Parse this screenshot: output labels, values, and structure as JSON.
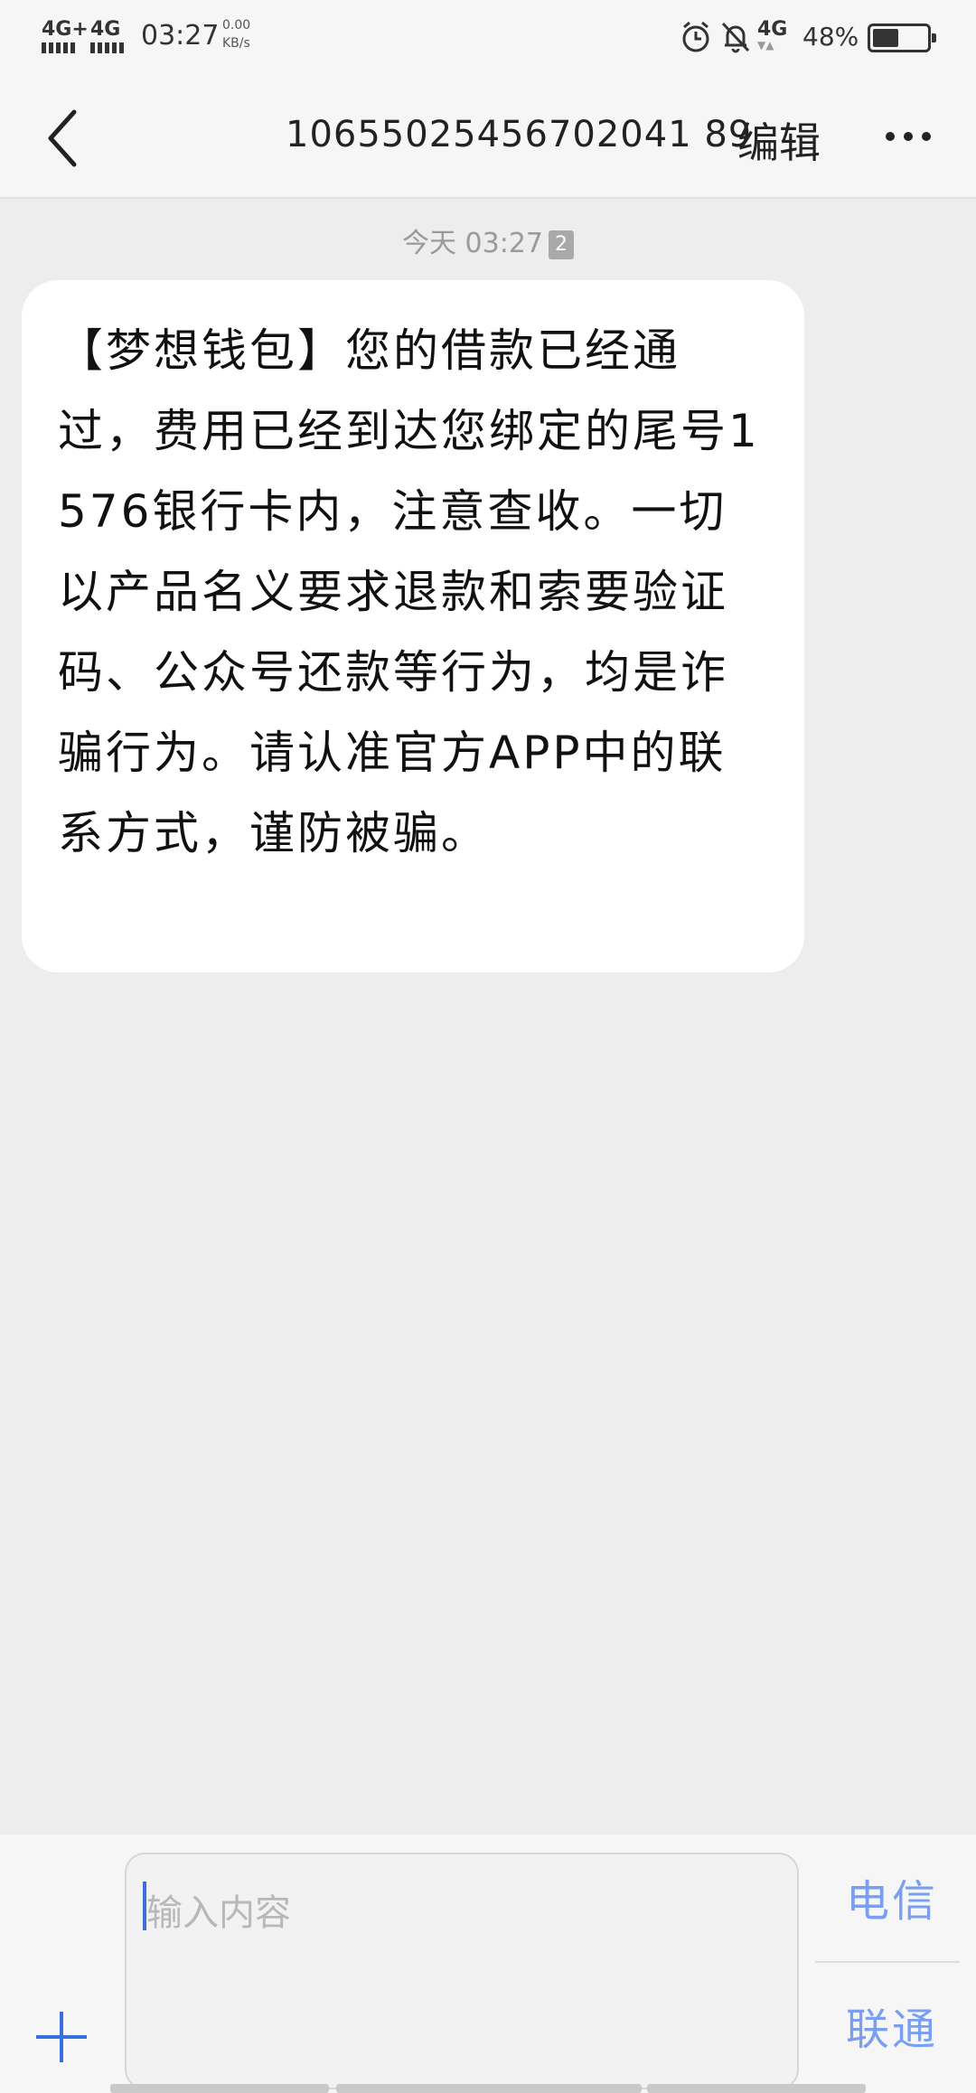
{
  "status_bar": {
    "network_1": "4G+",
    "network_2": "4G",
    "time": "03:27",
    "speed_value": "0.00",
    "speed_unit": "KB/s",
    "network_3": "4G",
    "battery": "48%",
    "battery_level": 0.48
  },
  "header": {
    "contact_number": "10655025456702041 89",
    "edit_label": "编辑"
  },
  "conversation": {
    "timestamp": "今天 03:27",
    "sim_badge": "2",
    "message_text": "【梦想钱包】您的借款已经通过，费用已经到达您绑定的尾号1576银行卡内，注意查收。一切以产品名义要求退款和索要验证码、公众号还款等行为，均是诈骗行为。请认准官方APP中的联系方式，谨防被骗。"
  },
  "composer": {
    "placeholder": "输入内容",
    "sim_1_label": "电信",
    "sim_2_label": "联通"
  },
  "colors": {
    "accent": "#3a6fe0",
    "sim_label": "#7b9ff0",
    "background": "#ededed",
    "bubble": "#ffffff"
  }
}
